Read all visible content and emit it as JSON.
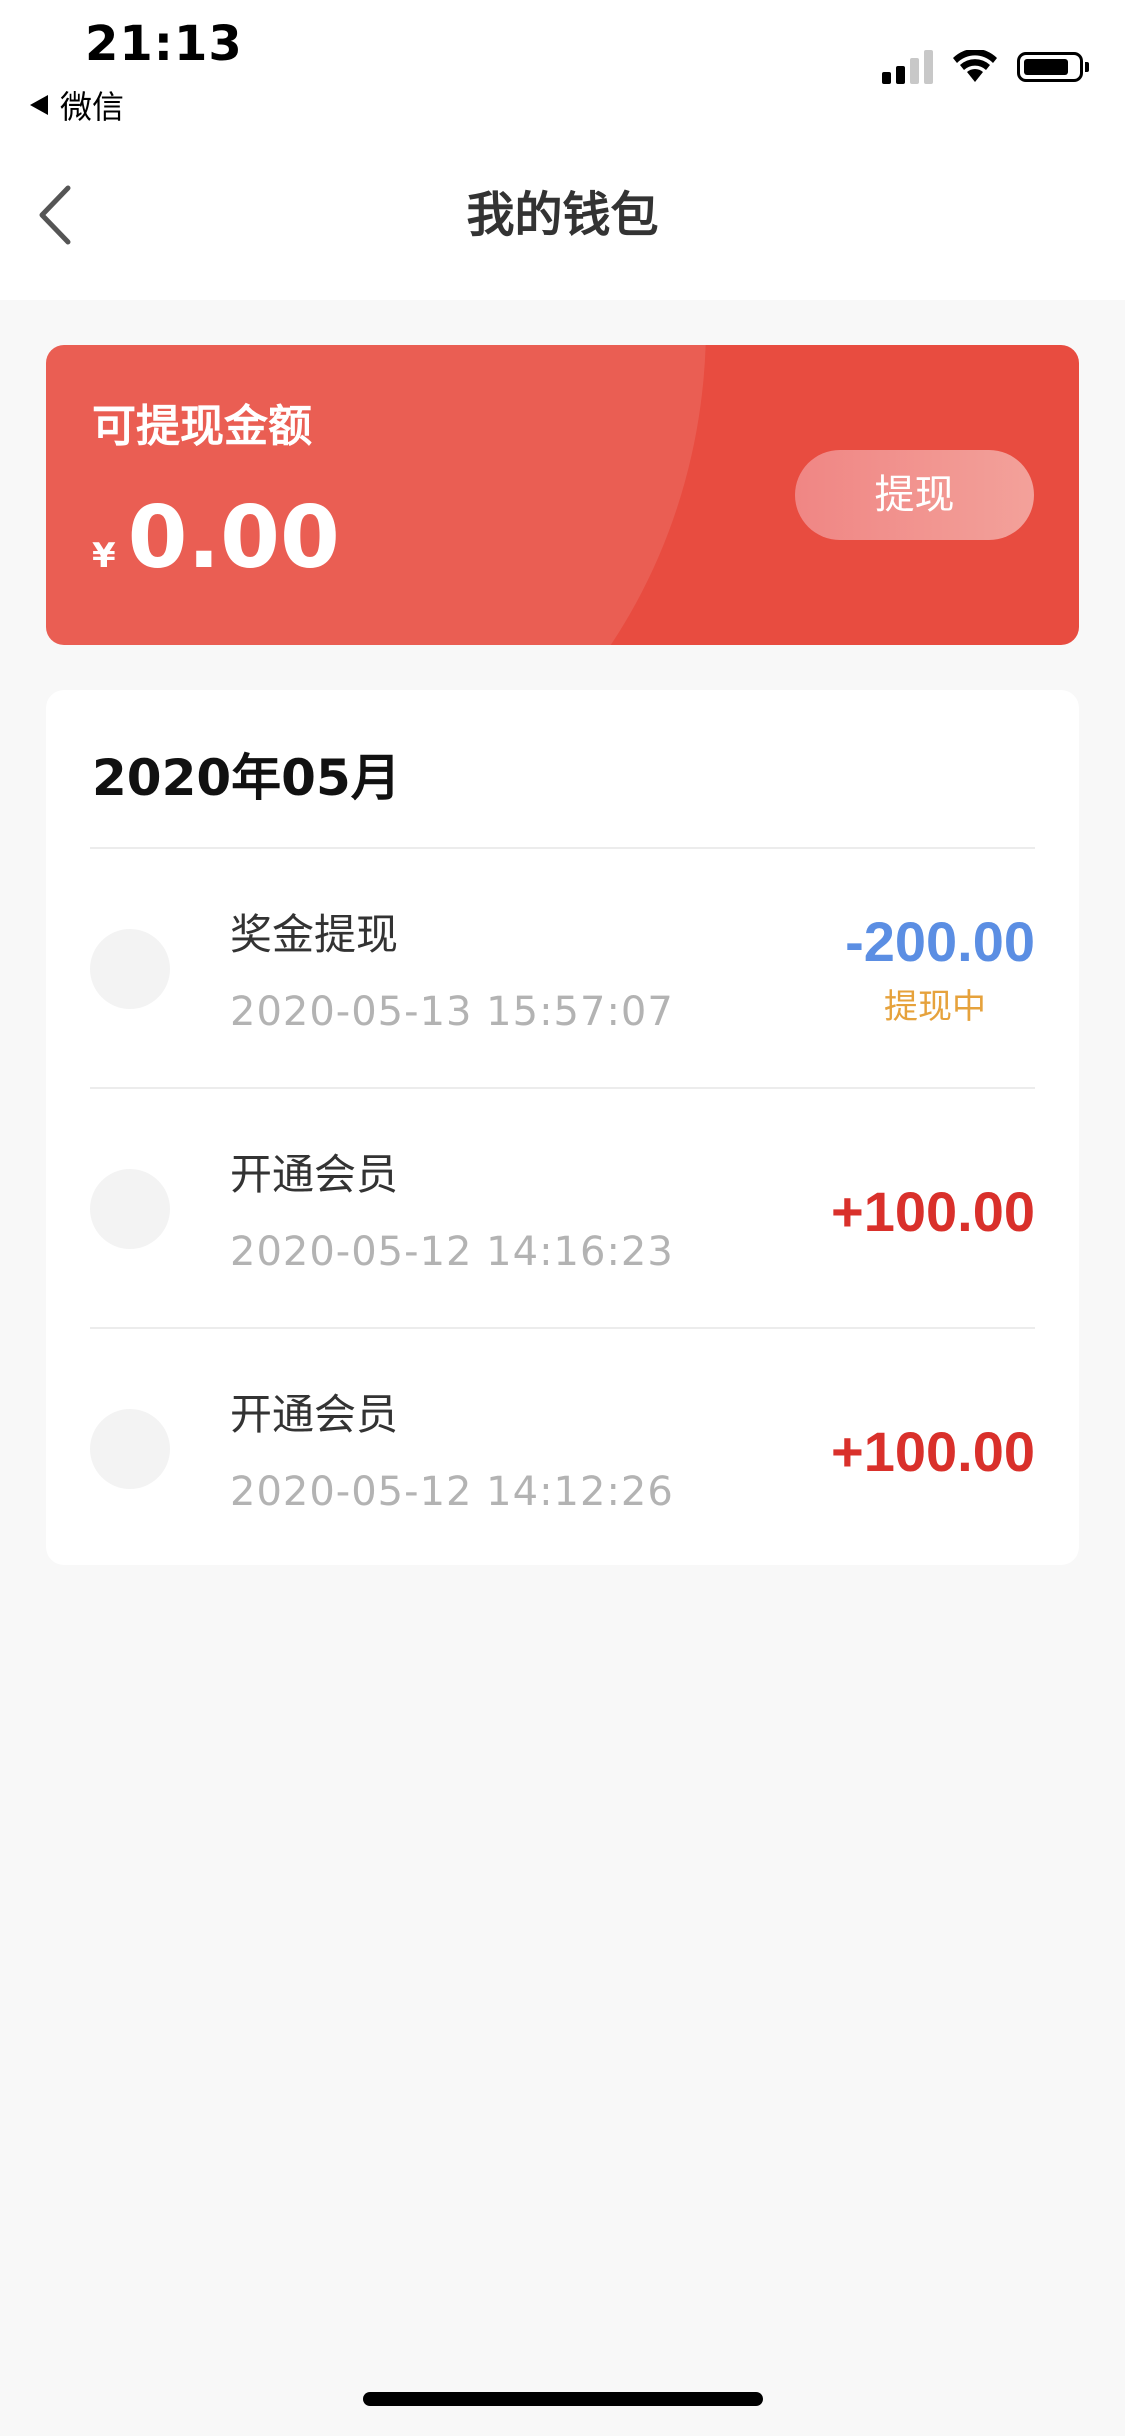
{
  "status_bar": {
    "time": "21:13",
    "back_app": "微信"
  },
  "nav": {
    "title": "我的钱包"
  },
  "balance": {
    "label": "可提现金额",
    "currency": "¥",
    "amount": "0.00",
    "withdraw_label": "提现"
  },
  "transactions": {
    "month": "2020年05月",
    "items": [
      {
        "title": "奖金提现",
        "datetime": "2020-05-13 15:57:07",
        "amount": "-200.00",
        "status": "提现中"
      },
      {
        "title": "开通会员",
        "datetime": "2020-05-12 14:16:23",
        "amount": "+100.00"
      },
      {
        "title": "开通会员",
        "datetime": "2020-05-12 14:12:26",
        "amount": "+100.00"
      }
    ]
  },
  "colors": {
    "card_red": "#e84c40",
    "amount_negative": "#5b8ee3",
    "amount_positive": "#d9302b",
    "status_pending": "#e6a23c"
  },
  "icons": {
    "back": "chevron-left-icon",
    "signal": "cellular-signal-icon",
    "wifi": "wifi-icon",
    "battery": "battery-icon"
  }
}
